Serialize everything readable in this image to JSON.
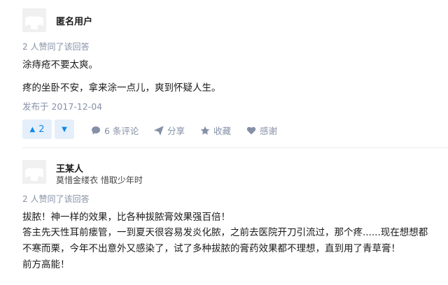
{
  "answers": [
    {
      "author": {
        "name": "匿名用户",
        "headline": ""
      },
      "upvote_info": "2 人赞同了该回答",
      "content": [
        "涂痔疮不要太爽。",
        "疼的坐卧不安，拿来涂一点儿，爽到怀疑人生。"
      ],
      "published": "发布于 2017-12-04",
      "votes": {
        "up_icon": "▲",
        "up_count": "2",
        "down_icon": "▼"
      },
      "actions": {
        "comments": "6 条评论",
        "share": "分享",
        "favorite": "收藏",
        "thanks": "感谢"
      }
    },
    {
      "author": {
        "name": "王某人",
        "headline": "莫惜金缕衣 惜取少年时"
      },
      "upvote_info": "2 人赞同了该回答",
      "content": [
        "拔脓！神一样的效果，比各种拔脓膏效果强百倍！",
        "答主先天性耳前瘘管，一到夏天很容易发炎化脓，之前去医院开刀引流过，那个疼......现在想想都",
        "不寒而栗，今年不出意外又感染了，试了多种拔脓的膏药效果都不理想，直到用了青草膏！",
        "前方高能！"
      ]
    }
  ],
  "colors": {
    "meta": "#8590a6",
    "accent": "#0f88eb",
    "vote_bg": "#e5effb",
    "text": "#1a1a1a"
  },
  "icons": [
    "avatar-placeholder-icon",
    "comment-icon",
    "share-icon",
    "star-icon",
    "heart-icon"
  ]
}
